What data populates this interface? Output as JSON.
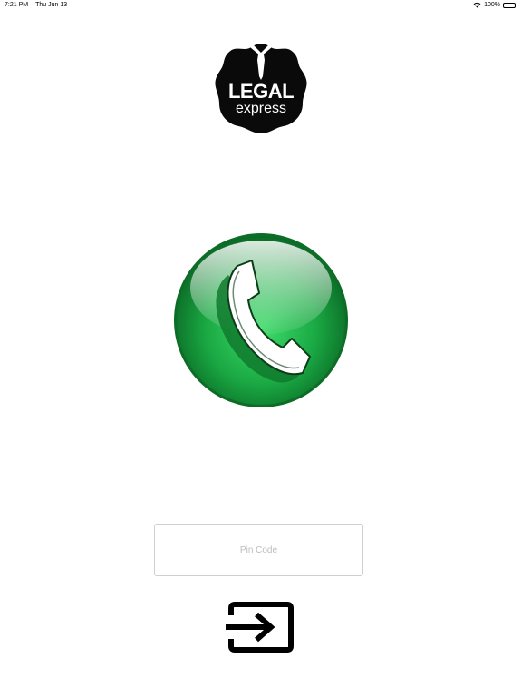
{
  "status_bar": {
    "time": "7:21 PM",
    "date": "Thu Jun 13",
    "battery_percent_label": "100%",
    "battery_level": 1.0,
    "wifi_icon": "wifi-icon",
    "battery_icon": "battery-icon"
  },
  "logo": {
    "line1": "LEGAL",
    "line2": "express",
    "icon": "tie-badge-logo",
    "badge_color": "#0a0a0a"
  },
  "call_button": {
    "icon": "phone-handset-icon",
    "color": "#1fb24a"
  },
  "pin_field": {
    "value": "",
    "placeholder": "Pin Code"
  },
  "login_button": {
    "icon": "sign-in-arrow-icon"
  }
}
